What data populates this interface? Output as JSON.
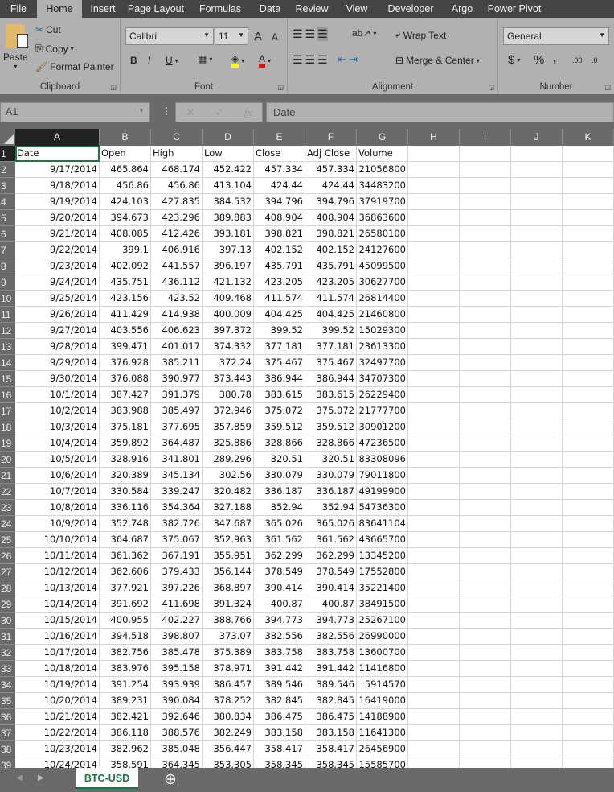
{
  "ribbon_tabs": [
    "File",
    "Home",
    "Insert",
    "Page Layout",
    "Formulas",
    "Data",
    "Review",
    "View",
    "Developer",
    "Argo",
    "Power Pivot"
  ],
  "active_tab": "Home",
  "clipboard": {
    "paste": "Paste",
    "cut": "Cut",
    "copy": "Copy",
    "format_painter": "Format Painter",
    "label": "Clipboard"
  },
  "font": {
    "name": "Calibri",
    "size": "11",
    "bold": "B",
    "italic": "I",
    "underline": "U",
    "grow": "A",
    "shrink": "A",
    "label": "Font",
    "fill_color": "#ffff00",
    "font_color": "#ff0000"
  },
  "alignment": {
    "wrap_text": "Wrap Text",
    "merge_center": "Merge & Center",
    "label": "Alignment"
  },
  "number": {
    "format": "General",
    "currency": "$",
    "percent": "%",
    "comma": ",",
    "inc_decimal": ".00",
    "dec_decimal": ".0",
    "label": "Number"
  },
  "formula_bar": {
    "name_box": "A1",
    "cancel": "✕",
    "enter": "✓",
    "fx": "fx",
    "value": "Date"
  },
  "columns": [
    "A",
    "B",
    "C",
    "D",
    "E",
    "F",
    "G",
    "H",
    "I",
    "J",
    "K"
  ],
  "headers": [
    "Date",
    "Open",
    "High",
    "Low",
    "Close",
    "Adj Close",
    "Volume"
  ],
  "rows": [
    [
      "9/17/2014",
      "465.864",
      "468.174",
      "452.422",
      "457.334",
      "457.334",
      "21056800"
    ],
    [
      "9/18/2014",
      "456.86",
      "456.86",
      "413.104",
      "424.44",
      "424.44",
      "34483200"
    ],
    [
      "9/19/2014",
      "424.103",
      "427.835",
      "384.532",
      "394.796",
      "394.796",
      "37919700"
    ],
    [
      "9/20/2014",
      "394.673",
      "423.296",
      "389.883",
      "408.904",
      "408.904",
      "36863600"
    ],
    [
      "9/21/2014",
      "408.085",
      "412.426",
      "393.181",
      "398.821",
      "398.821",
      "26580100"
    ],
    [
      "9/22/2014",
      "399.1",
      "406.916",
      "397.13",
      "402.152",
      "402.152",
      "24127600"
    ],
    [
      "9/23/2014",
      "402.092",
      "441.557",
      "396.197",
      "435.791",
      "435.791",
      "45099500"
    ],
    [
      "9/24/2014",
      "435.751",
      "436.112",
      "421.132",
      "423.205",
      "423.205",
      "30627700"
    ],
    [
      "9/25/2014",
      "423.156",
      "423.52",
      "409.468",
      "411.574",
      "411.574",
      "26814400"
    ],
    [
      "9/26/2014",
      "411.429",
      "414.938",
      "400.009",
      "404.425",
      "404.425",
      "21460800"
    ],
    [
      "9/27/2014",
      "403.556",
      "406.623",
      "397.372",
      "399.52",
      "399.52",
      "15029300"
    ],
    [
      "9/28/2014",
      "399.471",
      "401.017",
      "374.332",
      "377.181",
      "377.181",
      "23613300"
    ],
    [
      "9/29/2014",
      "376.928",
      "385.211",
      "372.24",
      "375.467",
      "375.467",
      "32497700"
    ],
    [
      "9/30/2014",
      "376.088",
      "390.977",
      "373.443",
      "386.944",
      "386.944",
      "34707300"
    ],
    [
      "10/1/2014",
      "387.427",
      "391.379",
      "380.78",
      "383.615",
      "383.615",
      "26229400"
    ],
    [
      "10/2/2014",
      "383.988",
      "385.497",
      "372.946",
      "375.072",
      "375.072",
      "21777700"
    ],
    [
      "10/3/2014",
      "375.181",
      "377.695",
      "357.859",
      "359.512",
      "359.512",
      "30901200"
    ],
    [
      "10/4/2014",
      "359.892",
      "364.487",
      "325.886",
      "328.866",
      "328.866",
      "47236500"
    ],
    [
      "10/5/2014",
      "328.916",
      "341.801",
      "289.296",
      "320.51",
      "320.51",
      "83308096"
    ],
    [
      "10/6/2014",
      "320.389",
      "345.134",
      "302.56",
      "330.079",
      "330.079",
      "79011800"
    ],
    [
      "10/7/2014",
      "330.584",
      "339.247",
      "320.482",
      "336.187",
      "336.187",
      "49199900"
    ],
    [
      "10/8/2014",
      "336.116",
      "354.364",
      "327.188",
      "352.94",
      "352.94",
      "54736300"
    ],
    [
      "10/9/2014",
      "352.748",
      "382.726",
      "347.687",
      "365.026",
      "365.026",
      "83641104"
    ],
    [
      "10/10/2014",
      "364.687",
      "375.067",
      "352.963",
      "361.562",
      "361.562",
      "43665700"
    ],
    [
      "10/11/2014",
      "361.362",
      "367.191",
      "355.951",
      "362.299",
      "362.299",
      "13345200"
    ],
    [
      "10/12/2014",
      "362.606",
      "379.433",
      "356.144",
      "378.549",
      "378.549",
      "17552800"
    ],
    [
      "10/13/2014",
      "377.921",
      "397.226",
      "368.897",
      "390.414",
      "390.414",
      "35221400"
    ],
    [
      "10/14/2014",
      "391.692",
      "411.698",
      "391.324",
      "400.87",
      "400.87",
      "38491500"
    ],
    [
      "10/15/2014",
      "400.955",
      "402.227",
      "388.766",
      "394.773",
      "394.773",
      "25267100"
    ],
    [
      "10/16/2014",
      "394.518",
      "398.807",
      "373.07",
      "382.556",
      "382.556",
      "26990000"
    ],
    [
      "10/17/2014",
      "382.756",
      "385.478",
      "375.389",
      "383.758",
      "383.758",
      "13600700"
    ],
    [
      "10/18/2014",
      "383.976",
      "395.158",
      "378.971",
      "391.442",
      "391.442",
      "11416800"
    ],
    [
      "10/19/2014",
      "391.254",
      "393.939",
      "386.457",
      "389.546",
      "389.546",
      "5914570"
    ],
    [
      "10/20/2014",
      "389.231",
      "390.084",
      "378.252",
      "382.845",
      "382.845",
      "16419000"
    ],
    [
      "10/21/2014",
      "382.421",
      "392.646",
      "380.834",
      "386.475",
      "386.475",
      "14188900"
    ],
    [
      "10/22/2014",
      "386.118",
      "388.576",
      "382.249",
      "383.158",
      "383.158",
      "11641300"
    ],
    [
      "10/23/2014",
      "382.962",
      "385.048",
      "356.447",
      "358.417",
      "358.417",
      "26456900"
    ],
    [
      "10/24/2014",
      "358.591",
      "364.345",
      "353.305",
      "358.345",
      "358.345",
      "15585700"
    ]
  ],
  "sheet_tab": "BTC-USD",
  "add_sheet": "⊕"
}
